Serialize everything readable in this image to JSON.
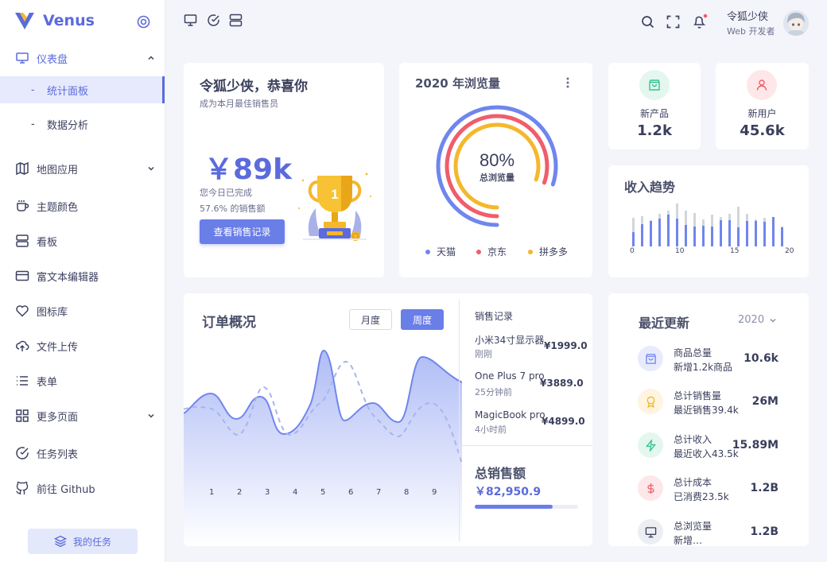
{
  "brand": {
    "name": "Venus",
    "accent": "#5b6bdc"
  },
  "sidebar": {
    "items": [
      {
        "label": "仪表盘",
        "icon": "monitor-icon"
      },
      {
        "label": "地图应用",
        "icon": "map-icon"
      },
      {
        "label": "主题颜色",
        "icon": "coffee-icon"
      },
      {
        "label": "看板",
        "icon": "server-icon"
      },
      {
        "label": "富文本编辑器",
        "icon": "credit-card-icon"
      },
      {
        "label": "图标库",
        "icon": "heart-icon"
      },
      {
        "label": "文件上传",
        "icon": "upload-cloud-icon"
      },
      {
        "label": "表单",
        "icon": "list-icon"
      },
      {
        "label": "更多页面",
        "icon": "grid-icon"
      },
      {
        "label": "任务列表",
        "icon": "check-circle-icon"
      },
      {
        "label": "前往 Github",
        "icon": "github-icon"
      }
    ],
    "subitems": [
      {
        "label": "统计面板",
        "active": true
      },
      {
        "label": "数据分析",
        "active": false
      }
    ],
    "dash": "-",
    "task_button": "我的任务"
  },
  "header": {
    "user_name": "令狐少侠",
    "user_role": "Web 开发者"
  },
  "welcome": {
    "title": "令狐少侠，恭喜你",
    "subtitle": "成为本月最佳销售员",
    "amount": "￥89k",
    "line1": "您今日已完成",
    "line2": "57.6% 的销售额",
    "button": "查看销售记录",
    "trophy_number": "1"
  },
  "views": {
    "title": "2020 年浏览量",
    "percent": "80%",
    "center_label": "总浏览量",
    "legend": [
      {
        "name": "天猫",
        "color": "#6f86ee"
      },
      {
        "name": "京东",
        "color": "#f05d6b"
      },
      {
        "name": "拼多多",
        "color": "#f5b72b"
      }
    ]
  },
  "stats": [
    {
      "label": "新产品",
      "value": "1.2k",
      "icon": "shopping-bag-icon",
      "color": "#34c38f"
    },
    {
      "label": "新用户",
      "value": "45.6k",
      "icon": "user-icon",
      "color": "#f05d6b"
    }
  ],
  "income": {
    "title": "收入趋势",
    "ticks": [
      "0",
      "10",
      "15",
      "20"
    ]
  },
  "orders": {
    "title": "订单概况",
    "tab_month": "月度",
    "tab_week": "周度",
    "x_ticks": [
      "1",
      "2",
      "3",
      "4",
      "5",
      "6",
      "7",
      "8",
      "9"
    ],
    "sales_heading": "销售记录",
    "sales": [
      {
        "name": "小米34寸显示器",
        "time": "刚刚",
        "price": "¥1999.0"
      },
      {
        "name": "One Plus 7 pro",
        "time": "25分钟前",
        "price": "¥3889.0"
      },
      {
        "name": "MagicBook pro",
        "time": "4小时前",
        "price": "¥4899.0"
      }
    ],
    "total_title": "总销售额",
    "total_value": "￥82,950.9",
    "total_progress": 0.75
  },
  "updates": {
    "title": "最近更新",
    "year": "2020",
    "rows": [
      {
        "label": "商品总量",
        "sub": "新增1.2k商品",
        "value": "10.6k",
        "icon": "shopping-bag-icon",
        "color": "#6f86ee"
      },
      {
        "label": "总计销售量",
        "sub": "最近销售39.4k",
        "value": "26M",
        "icon": "award-icon",
        "color": "#f5b72b"
      },
      {
        "label": "总计收入",
        "sub": "最近收入43.5k",
        "value": "15.89M",
        "icon": "zap-icon",
        "color": "#34c38f"
      },
      {
        "label": "总计成本",
        "sub": "已消费23.5k",
        "value": "1.2B",
        "icon": "dollar-icon",
        "color": "#f05d6b"
      },
      {
        "label": "总浏览量",
        "sub": "新增…",
        "value": "1.2B",
        "icon": "monitor-icon",
        "color": "#3a3f5c"
      }
    ]
  }
}
